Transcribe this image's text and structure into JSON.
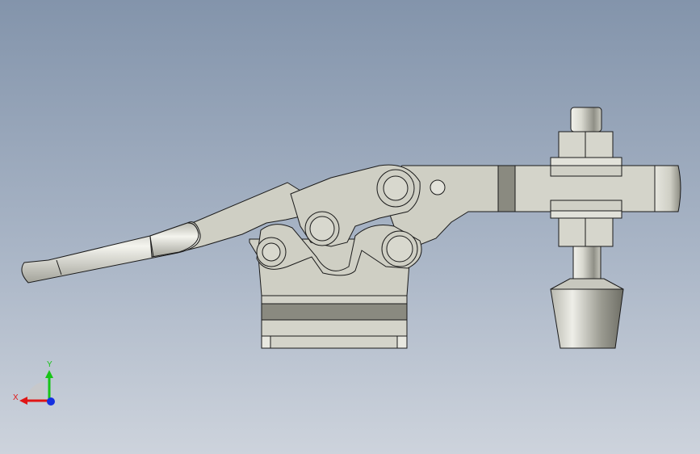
{
  "viewport": {
    "background_top": "#8394ab",
    "background_bottom": "#cdd3dc"
  },
  "model": {
    "part_fill": "#cfcfc4",
    "part_edge": "#1a1a1a",
    "dark_band": "#8a8a80"
  },
  "triad": {
    "x_label": "X",
    "y_label": "Y",
    "x_color": "#e01515",
    "y_color": "#18c418",
    "z_color": "#1530e0"
  }
}
